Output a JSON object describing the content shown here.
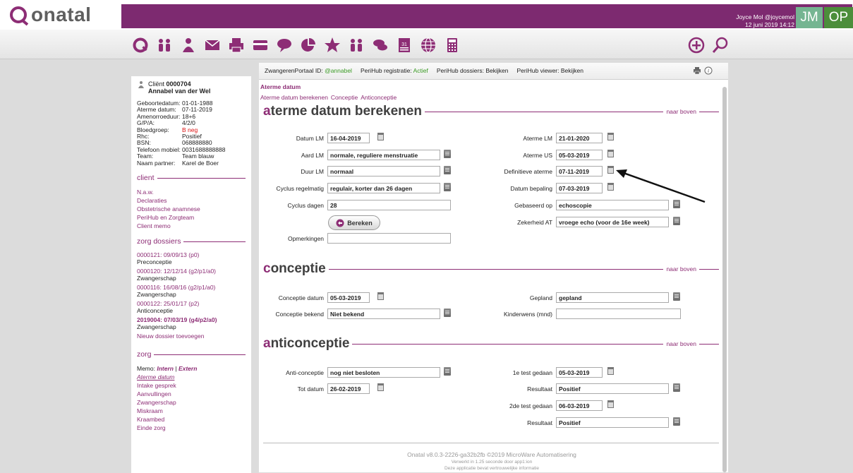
{
  "header": {
    "logo_text": "onatal",
    "user_line": "Joyce Mol @joycemol",
    "datetime": "12 juni 2019 14:12",
    "badge_jm": "JM",
    "badge_op": "OP",
    "brand_color": "#7d2a70"
  },
  "toolbar": {
    "icons": [
      "onatal-home-icon",
      "people-icon",
      "client-icon",
      "mail-icon",
      "print-icon",
      "card-icon",
      "chat-bubble-icon",
      "chart-pie-icon",
      "star-icon",
      "people-icon",
      "chat-icon",
      "calendar-icon",
      "globe-icon",
      "calculator-icon",
      "add-icon",
      "search-icon"
    ]
  },
  "sidebar": {
    "client_label": "Cliënt",
    "client_number": "0000704",
    "client_name": "Annabel van der Wel",
    "info": [
      {
        "k": "Geboortedatum:",
        "v": "01-01-1988"
      },
      {
        "k": "Aterme datum:",
        "v": "07-11-2019"
      },
      {
        "k": "Amenorroeduur:",
        "v": "18+6"
      },
      {
        "k": "G/P/A:",
        "v": "4/2/0"
      },
      {
        "k": "Bloedgroep:",
        "v": "B neg"
      },
      {
        "k": "Rhc:",
        "v": "Positief"
      },
      {
        "k": "BSN:",
        "v": "068888880"
      },
      {
        "k": "Telefoon mobiel:",
        "v": "0031688888888"
      },
      {
        "k": "Team:",
        "v": "Team blauw"
      },
      {
        "k": "Naam partner:",
        "v": "Karel de Boer"
      }
    ],
    "client_section": "client",
    "client_links": [
      "N.a.w.",
      "Declaraties",
      "Obstetrische anamnese",
      "PeriHub en Zorgteam",
      "Client memo"
    ],
    "dossiers_section": "zorg dossiers",
    "dossiers": [
      {
        "link": "0000121: 09/09/13 (p0)",
        "type": "Preconceptie"
      },
      {
        "link": "0000120: 12/12/14 (g2/p1/a0)",
        "type": "Zwangerschap"
      },
      {
        "link": "0000116: 16/08/16 (g2/p1/a0)",
        "type": "Zwangerschap"
      },
      {
        "link": "0000122: 25/01/17 (p2)",
        "type": "Anticonceptie"
      },
      {
        "link": "2019004: 07/03/19 (g4/p2/a0)",
        "type": "Zwangerschap"
      }
    ],
    "new_dossier": "Nieuw dossier toevoegen",
    "zorg_section": "zorg",
    "memo_label": "Memo:",
    "memo_intern": "Intern",
    "memo_sep": "|",
    "memo_extern": "Extern",
    "zorg_links": [
      "Aterme datum",
      "Intake gesprek",
      "Aanvullingen",
      "Zwangerschap",
      "Miskraam",
      "Kraambed",
      "Einde zorg"
    ]
  },
  "infobar": {
    "portal_label": "ZwangerenPortaal ID:",
    "portal_value": "@annabel",
    "reg_label": "PeriHub registratie:",
    "reg_value": "Actief",
    "dossiers_label": "PeriHub dossiers:",
    "dossiers_value": "Bekijken",
    "viewer_label": "PeriHub viewer:",
    "viewer_value": "Bekijken"
  },
  "breadcrumb": "Aterme datum",
  "sublinks": [
    "Aterme datum berekenen",
    "Conceptie",
    "Anticonceptie"
  ],
  "naar_boven": "naar boven",
  "sec1": {
    "title_first": "a",
    "title_rest": "terme datum berekenen",
    "datum_lm_label": "Datum LM",
    "datum_lm": "16-04-2019",
    "aard_lm_label": "Aard LM",
    "aard_lm": "normale, reguliere menstruatie",
    "duur_lm_label": "Duur LM",
    "duur_lm": "normaal",
    "cyclus_label": "Cyclus regelmatig",
    "cyclus": "regulair, korter dan 26 dagen",
    "dagen_label": "Cyclus dagen",
    "dagen": "28",
    "bereken": "Bereken",
    "opm_label": "Opmerkingen",
    "opm": "",
    "aterme_lm_label": "Aterme LM",
    "aterme_lm": "21-01-2020",
    "aterme_us_label": "Aterme US",
    "aterme_us": "05-03-2019",
    "def_label": "Definitieve aterme",
    "def": "07-11-2019",
    "bepaling_label": "Datum bepaling",
    "bepaling": "07-03-2019",
    "gebaseerd_label": "Gebaseerd op",
    "gebaseerd": "echoscopie",
    "zeker_label": "Zekerheid AT",
    "zeker": "vroege echo (voor de 16e week)"
  },
  "sec2": {
    "title_first": "c",
    "title_rest": "onceptie",
    "datum_label": "Conceptie datum",
    "datum": "05-03-2019",
    "bekend_label": "Conceptie bekend",
    "bekend": "Niet bekend",
    "gepland_label": "Gepland",
    "gepland": "gepland",
    "kinderwens_label": "Kinderwens (mnd)",
    "kinderwens": ""
  },
  "sec3": {
    "title_first": "a",
    "title_rest": "nticonceptie",
    "anti_label": "Anti-conceptie",
    "anti": "nog niet besloten",
    "tot_label": "Tot datum",
    "tot": "26-02-2019",
    "test1_label": "1e test gedaan",
    "test1": "05-03-2019",
    "res1_label": "Resultaat",
    "res1": "Positief",
    "test2_label": "2de test gedaan",
    "test2": "06-03-2019",
    "res2_label": "Resultaat",
    "res2": "Positief"
  },
  "footer": {
    "line1": "Onatal v8.0.3-2226-ga32b2fb ©2019 MicroWare Automatisering",
    "line2": "Verwerkt in 1.25 seconde door app1:ion",
    "line3": "Deze applicatie bevat vertrouwelijke informatie"
  }
}
